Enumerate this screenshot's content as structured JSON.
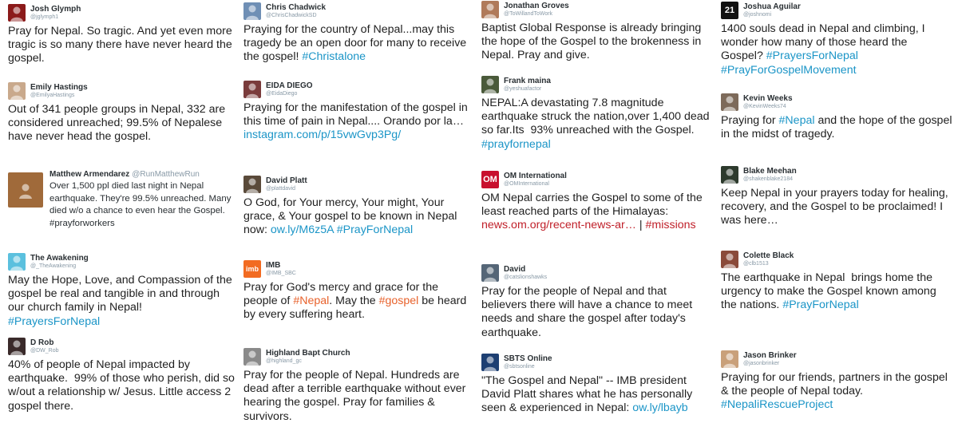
{
  "colors": {
    "hashtag": "#1b95c7",
    "orange_tag": "#e8622c",
    "red_link": "#c0202a"
  },
  "tweets": [
    {
      "name": "Josh Glymph",
      "handle": "@jglymph1",
      "avatar_icon": "person-dark-red-icon",
      "avatar_color": "#8b1a1a",
      "parts": [
        {
          "t": "Pray for Nepal. So tragic. And yet even more tragic is so many there have never heard the gospel."
        }
      ]
    },
    {
      "name": "Chris Chadwick",
      "handle": "@ChrisChadwickSD",
      "avatar_icon": "person-photo-icon",
      "avatar_color": "#6f8fb5",
      "parts": [
        {
          "t": "Praying for the country of Nepal...may this tragedy be an open door for many to receive the gospel! "
        },
        {
          "t": "#Christalone",
          "c": "tag"
        }
      ]
    },
    {
      "name": "Jonathan Groves",
      "handle": "@ToWillandToWork",
      "avatar_icon": "person-photo-icon",
      "avatar_color": "#b07a5a",
      "parts": [
        {
          "t": "Baptist Global Response is already bringing the hope of the Gospel to the brokenness in Nepal. Pray and give."
        }
      ]
    },
    {
      "name": "Joshua Aguilar",
      "handle": "@joshnomi",
      "avatar_icon": "number-21-icon",
      "avatar_color": "#111111",
      "avatar_text": "21",
      "parts": [
        {
          "t": "1400 souls dead in Nepal and climbing, I wonder how many of those heard the Gospel? "
        },
        {
          "t": "#PrayersForNepal",
          "c": "tag"
        },
        {
          "t": " "
        },
        {
          "t": "#PrayForGospelMovement",
          "c": "tag"
        }
      ]
    },
    {
      "name": "Emily Hastings",
      "handle": "@EmilyaHastings",
      "avatar_icon": "person-photo-icon",
      "avatar_color": "#c9a98c",
      "parts": [
        {
          "t": "Out of 341 people groups in Nepal, 332 are considered unreached; 99.5% of Nepalese have never head the gospel."
        }
      ]
    },
    {
      "name": "EIDA DIEGO",
      "handle": "@EidaDiego",
      "avatar_icon": "person-photo-icon",
      "avatar_color": "#7a3b3b",
      "parts": [
        {
          "t": "Praying for the manifestation of the gospel in this time of pain in Nepal.... Orando por la… "
        },
        {
          "t": "instagram.com/p/15vwGvp3Pg/",
          "c": "tag"
        }
      ]
    },
    {
      "name": "Frank maina",
      "handle": "@yeshuafactor",
      "avatar_icon": "person-photo-icon",
      "avatar_color": "#4a5a3a",
      "parts": [
        {
          "t": "NEPAL:A devastating 7.8 magnitude earthquake struck the nation,over 1,400 dead so far.Its  93% unreached with the Gospel. "
        },
        {
          "t": "#prayfornepal",
          "c": "tag"
        }
      ]
    },
    {
      "name": "Kevin Weeks",
      "handle": "@KevinWeeks74",
      "avatar_icon": "person-photo-icon",
      "avatar_color": "#7d6a5a",
      "parts": [
        {
          "t": "Praying for "
        },
        {
          "t": "#Nepal",
          "c": "tag"
        },
        {
          "t": " and the hope of the gospel in the midst of tragedy."
        }
      ]
    },
    {
      "name": "Matthew Armendarez",
      "handle": "@RunMatthewRun",
      "avatar_icon": "person-photo-icon",
      "avatar_color": "#a06a3a",
      "small": true,
      "parts": [
        {
          "t": "Over 1,500 ppl died last night in Nepal earthquake. They're 99.5% unreached. Many died w/o a chance to even hear the Gospel. #prayforworkers"
        }
      ]
    },
    {
      "name": "David Platt",
      "handle": "@plattdavid",
      "avatar_icon": "person-photo-icon",
      "avatar_color": "#5a4a3a",
      "parts": [
        {
          "t": "O God, for Your mercy, Your might, Your grace, & Your gospel to be known in Nepal now: "
        },
        {
          "t": "ow.ly/M6z5A",
          "c": "tag"
        },
        {
          "t": " "
        },
        {
          "t": "#PrayForNepal",
          "c": "tag"
        }
      ]
    },
    {
      "name": "OM International",
      "handle": "@OMInternational",
      "avatar_icon": "om-logo-icon",
      "avatar_color": "#c8102e",
      "avatar_text": "OM",
      "parts": [
        {
          "t": "OM Nepal carries the Gospel to some of the least reached parts of the Himalayas: "
        },
        {
          "t": "news.om.org/recent-news-ar…",
          "c": "tag-red"
        },
        {
          "t": " | "
        },
        {
          "t": "#missions",
          "c": "tag-red"
        }
      ]
    },
    {
      "name": "Blake Meehan",
      "handle": "@shakenblake2184",
      "avatar_icon": "person-photo-icon",
      "avatar_color": "#2d3a2d",
      "parts": [
        {
          "t": "Keep Nepal in your prayers today for healing, recovery, and the Gospel to be proclaimed! I was here…"
        }
      ]
    },
    {
      "name": "The Awakening",
      "handle": "@_TheAwakening",
      "avatar_icon": "awakening-logo-icon",
      "avatar_color": "#5bc0de",
      "parts": [
        {
          "t": "May the Hope, Love, and Compassion of the gospel be real and tangible in and through our church family in Nepal! "
        },
        {
          "t": "#PrayersForNepal",
          "c": "tag"
        }
      ]
    },
    {
      "name": "IMB",
      "handle": "@IMB_SBC",
      "avatar_icon": "imb-logo-icon",
      "avatar_color": "#f26b21",
      "avatar_text": "imb",
      "parts": [
        {
          "t": "Pray for God's mercy and grace for the people of "
        },
        {
          "t": "#Nepal",
          "c": "tag-orange"
        },
        {
          "t": ". May the "
        },
        {
          "t": "#gospel",
          "c": "tag-orange"
        },
        {
          "t": " be heard by every suffering heart."
        }
      ]
    },
    {
      "name": "David",
      "handle": "@catslionshawks",
      "avatar_icon": "mountain-photo-icon",
      "avatar_color": "#556677",
      "parts": [
        {
          "t": "Pray for the people of Nepal and that believers there will have a chance to meet needs and share the gospel after today's earthquake."
        }
      ]
    },
    {
      "name": "Colette Black",
      "handle": "@clb1513",
      "avatar_icon": "person-photo-icon",
      "avatar_color": "#8a4a3a",
      "parts": [
        {
          "t": "The earthquake in Nepal  brings home the urgency to make the Gospel known among the nations. "
        },
        {
          "t": "#PrayForNepal",
          "c": "tag"
        }
      ]
    },
    {
      "name": "D Rob",
      "handle": "@DW_Rob",
      "avatar_icon": "person-photo-icon",
      "avatar_color": "#3a2a2a",
      "parts": [
        {
          "t": "40% of people of Nepal impacted by earthquake.  99% of those who perish, did so w/out a relationship w/ Jesus. Little access 2 gospel there."
        }
      ]
    },
    {
      "name": "Highland Bapt Church",
      "handle": "@highland_gc",
      "avatar_icon": "highland-logo-icon",
      "avatar_color": "#8a8a8a",
      "parts": [
        {
          "t": "Pray for the people of Nepal. Hundreds are dead after a terrible earthquake without ever hearing the gospel. Pray for families & survivors."
        }
      ]
    },
    {
      "name": "SBTS Online",
      "handle": "@sbtsonline",
      "avatar_icon": "sbts-logo-icon",
      "avatar_color": "#1d3f72",
      "parts": [
        {
          "t": "\"The Gospel and Nepal\" -- IMB president David Platt shares what he has personally seen & experienced in Nepal: "
        },
        {
          "t": "ow.ly/lbayb",
          "c": "tag"
        }
      ]
    },
    {
      "name": "Jason Brinker",
      "handle": "@jasonbrinker",
      "avatar_icon": "person-photo-icon",
      "avatar_color": "#c9a07a",
      "parts": [
        {
          "t": "Praying for our friends, partners in the gospel & the people of Nepal today. "
        },
        {
          "t": "#NepaliRescueProject",
          "c": "tag"
        }
      ]
    }
  ]
}
